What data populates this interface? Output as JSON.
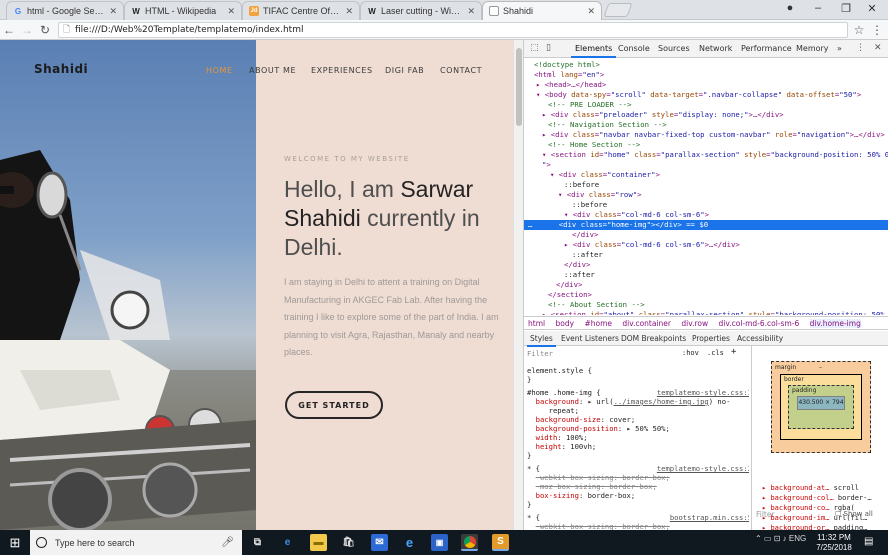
{
  "browser": {
    "tabs": [
      {
        "title": "html - Google Search",
        "icon": "google-icon",
        "icon_letter": "G"
      },
      {
        "title": "HTML - Wikipedia",
        "icon": "wikipedia-icon",
        "icon_letter": "W"
      },
      {
        "title": "TIFAC Centre Of Relevance",
        "icon": "jd-icon",
        "icon_letter": "Jd"
      },
      {
        "title": "Laser cutting - Wikipedia",
        "icon": "wikipedia-icon",
        "icon_letter": "W"
      },
      {
        "title": "Shahidi",
        "icon": "page-icon",
        "icon_letter": ""
      }
    ],
    "url": "file:///D:/Web%20Template/templatemo/index.html"
  },
  "site": {
    "brand": "Shahidi",
    "nav": [
      "HOME",
      "ABOUT ME",
      "EXPERIENCES",
      "DIGI FAB",
      "CONTACT"
    ],
    "welcome": "WELCOME TO MY WEBSITE",
    "headline_1": "Hello, I am ",
    "headline_name1": "Sarwar",
    "headline_name2": "Shahidi",
    "headline_2": " currently in Delhi.",
    "intro": "I am staying in Delhi to attent a training on Digital Manufacturing in AKGEC Fab Lab. After having the training I like to explore some of the part of India. I am planning to visit Agra, Rajasthan, Manaly and nearby places.",
    "cta": "GET STARTED",
    "accent": "#e6953e"
  },
  "devtools": {
    "tabs": [
      "Elements",
      "Console",
      "Sources",
      "Network",
      "Performance",
      "Memory",
      "»"
    ],
    "breadcrumbs": [
      "html",
      "body",
      "#home",
      "div.container",
      "div.row",
      "div.col-md-6.col-sm-6",
      "div.home-img"
    ],
    "subtabs": [
      "Styles",
      "Event Listeners",
      "DOM Breakpoints",
      "Properties",
      "Accessibility"
    ],
    "filter_placeholder": "Filter",
    "hov": ":hov",
    "cls": ".cls",
    "box": {
      "margin": "margin",
      "border": "border",
      "padding": "padding",
      "content": "430.500 × 794",
      "dash": "–"
    },
    "filter2": "Filter",
    "show_all": "Show all",
    "computed": [
      {
        "prop": "background-at…",
        "val": "scroll"
      },
      {
        "prop": "background-col…",
        "val": "border-…"
      },
      {
        "prop": "background-co…",
        "val": "rgba("
      },
      {
        "prop": "background-im…",
        "val": "url(fil…"
      },
      {
        "prop": "background-or…",
        "val": "padding…"
      }
    ]
  },
  "taskbar": {
    "search": "Type here to search",
    "time": "11:32 PM",
    "date": "7/25/2018"
  }
}
